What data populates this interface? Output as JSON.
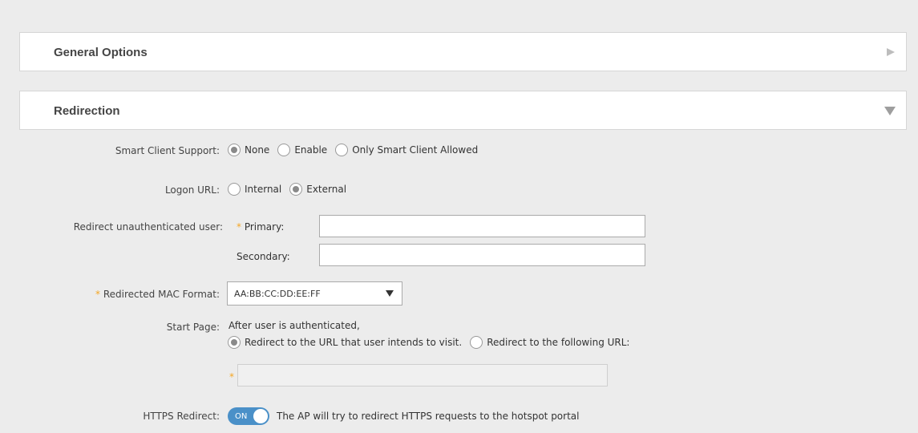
{
  "panels": {
    "general": {
      "title": "General Options",
      "icon": "triangle-right-icon"
    },
    "redirection": {
      "title": "Redirection",
      "icon": "triangle-down-icon"
    }
  },
  "smart_client": {
    "label": "Smart Client Support:",
    "options": [
      {
        "label": "None",
        "checked": true
      },
      {
        "label": "Enable",
        "checked": false
      },
      {
        "label": "Only Smart Client Allowed",
        "checked": false
      }
    ]
  },
  "logon_url": {
    "label": "Logon URL:",
    "options": [
      {
        "label": "Internal",
        "checked": false
      },
      {
        "label": "External",
        "checked": true
      }
    ]
  },
  "redirect_unauth": {
    "label": "Redirect unauthenticated user:",
    "required_mark": "*",
    "primary_label": "Primary:",
    "primary_value": "",
    "secondary_label": "Secondary:",
    "secondary_value": ""
  },
  "mac_format": {
    "required_mark": "*",
    "label": "Redirected MAC Format:",
    "selected": "AA:BB:CC:DD:EE:FF",
    "icon": "dropdown-arrow-icon"
  },
  "start_page": {
    "label": "Start Page:",
    "description": "After user is authenticated,",
    "options": [
      {
        "label": "Redirect to the URL that user intends to visit.",
        "checked": true
      },
      {
        "label": "Redirect to the following URL:",
        "checked": false
      }
    ],
    "url_required_mark": "*",
    "url_value": ""
  },
  "https_redirect": {
    "label": "HTTPS Redirect:",
    "toggle_text": "ON",
    "enabled": true,
    "description": "The AP will try to redirect HTTPS requests to the hotspot portal"
  },
  "colors": {
    "accent": "#4a90c8",
    "required": "#f5a623",
    "background": "#ececec"
  }
}
